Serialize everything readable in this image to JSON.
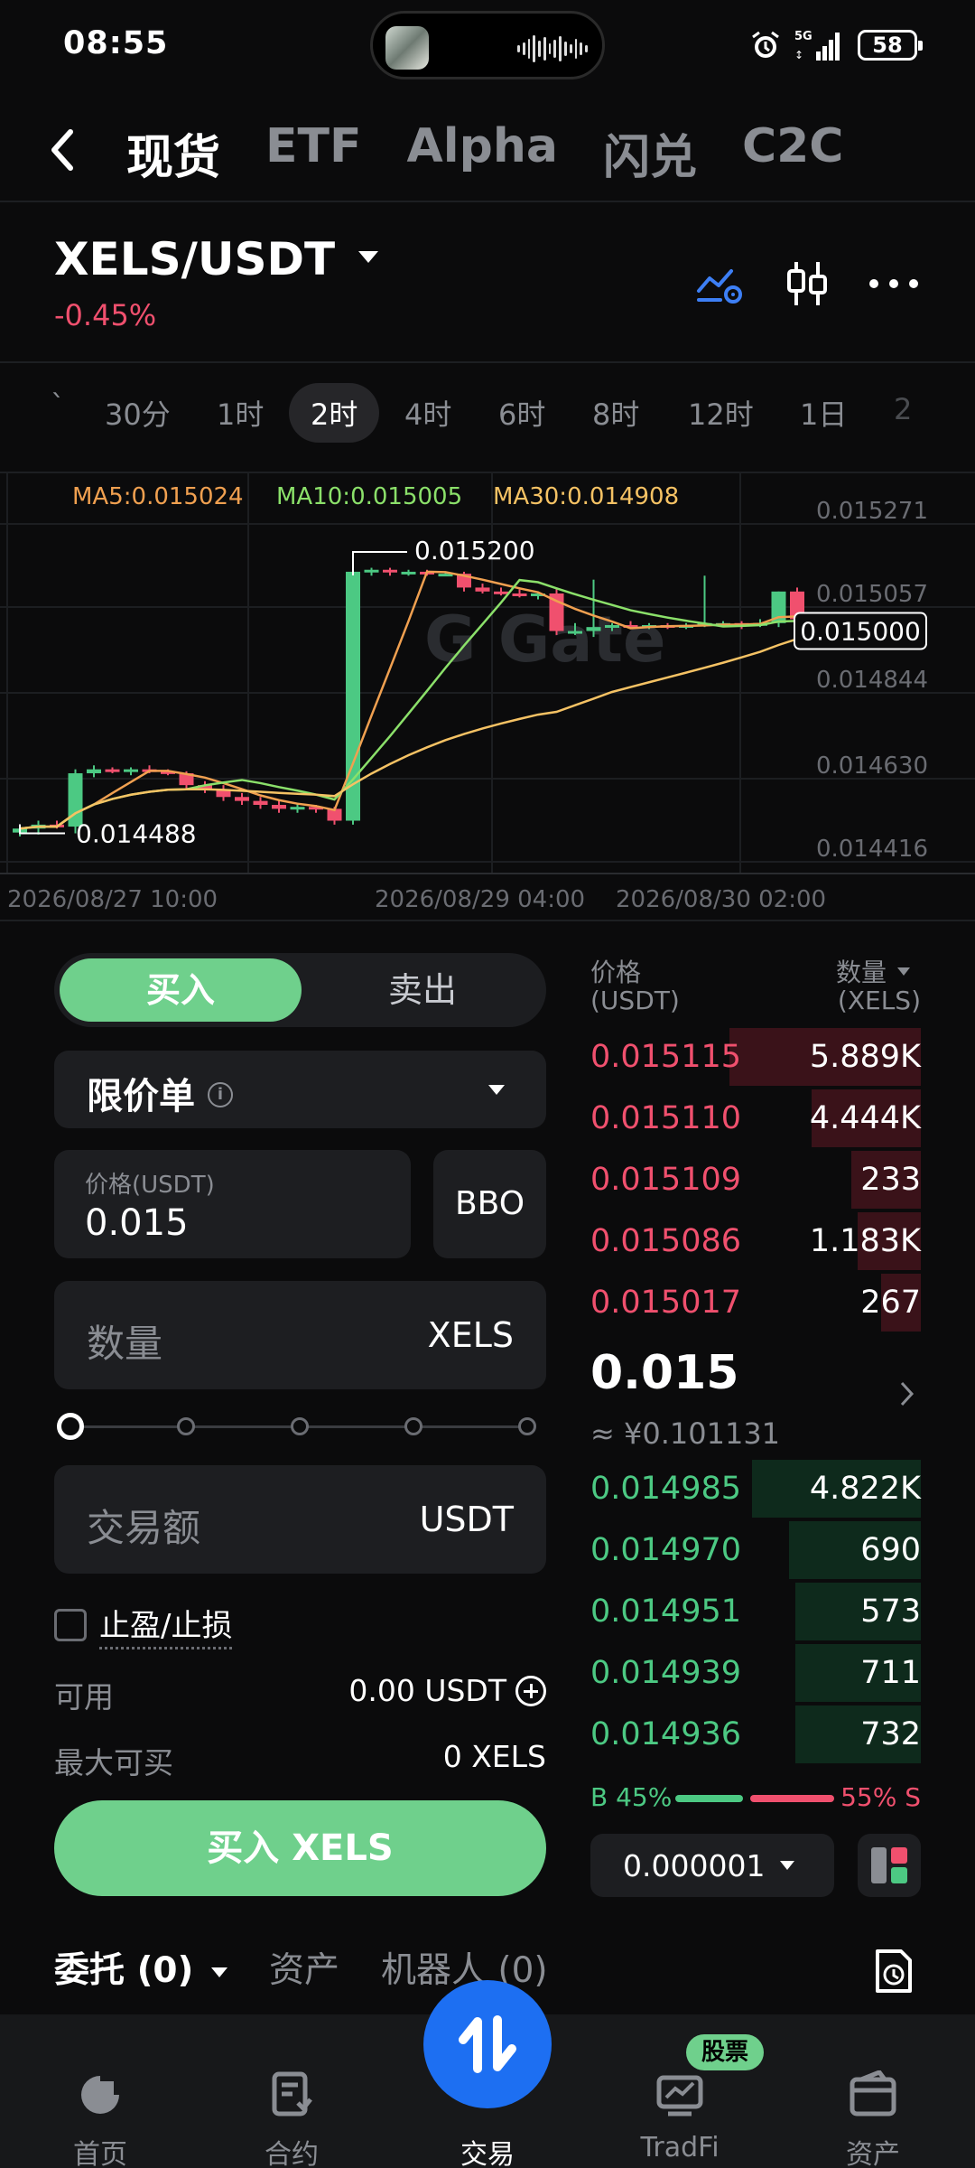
{
  "status": {
    "time": "08:55",
    "battery": "58",
    "network": "5G"
  },
  "topnav": {
    "tabs": [
      "现货",
      "ETF",
      "Alpha",
      "闪兑",
      "C2C"
    ],
    "active": 0
  },
  "pair": {
    "symbol": "XELS/USDT",
    "change": "-0.45%"
  },
  "timeframes": {
    "items": [
      "30分",
      "1时",
      "2时",
      "4时",
      "6时",
      "8时",
      "12时",
      "1日",
      "2"
    ],
    "active": "2时"
  },
  "chart_data": {
    "type": "candlestick",
    "ma": [
      {
        "name": "MA5",
        "label": "MA5:0.015024",
        "color": "#f0a050"
      },
      {
        "name": "MA10",
        "label": "MA10:0.015005",
        "color": "#8be06a"
      },
      {
        "name": "MA30",
        "label": "MA30:0.014908",
        "color": "#f5c264"
      }
    ],
    "y_ticks": [
      "0.015271",
      "0.015057",
      "0.014844",
      "0.014630",
      "0.014416"
    ],
    "x_ticks": [
      "2026/08/27 10:00",
      "2026/08/29 04:00",
      "2026/08/30 02:00"
    ],
    "high_label": "0.015200",
    "low_label": "0.014488",
    "last_price": "0.015000",
    "candles": [
      {
        "o": 0.01449,
        "h": 0.0145,
        "l": 0.01448,
        "c": 0.0145
      },
      {
        "o": 0.0145,
        "h": 0.01452,
        "l": 0.014485,
        "c": 0.01451
      },
      {
        "o": 0.01451,
        "h": 0.01452,
        "l": 0.0145,
        "c": 0.014505
      },
      {
        "o": 0.014505,
        "h": 0.01465,
        "l": 0.014488,
        "c": 0.01464
      },
      {
        "o": 0.01464,
        "h": 0.01466,
        "l": 0.01463,
        "c": 0.01465
      },
      {
        "o": 0.01465,
        "h": 0.014655,
        "l": 0.01464,
        "c": 0.014645
      },
      {
        "o": 0.014645,
        "h": 0.014655,
        "l": 0.014635,
        "c": 0.01465
      },
      {
        "o": 0.01465,
        "h": 0.01466,
        "l": 0.01464,
        "c": 0.014645
      },
      {
        "o": 0.014645,
        "h": 0.01465,
        "l": 0.014635,
        "c": 0.01464
      },
      {
        "o": 0.01464,
        "h": 0.014645,
        "l": 0.0146,
        "c": 0.01461
      },
      {
        "o": 0.01461,
        "h": 0.01462,
        "l": 0.01459,
        "c": 0.0146
      },
      {
        "o": 0.0146,
        "h": 0.01461,
        "l": 0.01457,
        "c": 0.01458
      },
      {
        "o": 0.01458,
        "h": 0.01459,
        "l": 0.01456,
        "c": 0.01457
      },
      {
        "o": 0.01457,
        "h": 0.01458,
        "l": 0.01455,
        "c": 0.01456
      },
      {
        "o": 0.01456,
        "h": 0.01457,
        "l": 0.01454,
        "c": 0.01455
      },
      {
        "o": 0.01455,
        "h": 0.014565,
        "l": 0.01454,
        "c": 0.014555
      },
      {
        "o": 0.014555,
        "h": 0.01456,
        "l": 0.01454,
        "c": 0.01455
      },
      {
        "o": 0.01455,
        "h": 0.014555,
        "l": 0.01451,
        "c": 0.01452
      },
      {
        "o": 0.01452,
        "h": 0.0152,
        "l": 0.01451,
        "c": 0.01515
      },
      {
        "o": 0.01515,
        "h": 0.01516,
        "l": 0.01514,
        "c": 0.015155
      },
      {
        "o": 0.015155,
        "h": 0.01516,
        "l": 0.01514,
        "c": 0.01515
      },
      {
        "o": 0.01515,
        "h": 0.015155,
        "l": 0.01514,
        "c": 0.01515
      },
      {
        "o": 0.01515,
        "h": 0.015155,
        "l": 0.01514,
        "c": 0.015145
      },
      {
        "o": 0.015145,
        "h": 0.01515,
        "l": 0.01514,
        "c": 0.015145
      },
      {
        "o": 0.015145,
        "h": 0.01515,
        "l": 0.0151,
        "c": 0.01511
      },
      {
        "o": 0.01511,
        "h": 0.01512,
        "l": 0.015095,
        "c": 0.0151
      },
      {
        "o": 0.0151,
        "h": 0.01511,
        "l": 0.01509,
        "c": 0.015095
      },
      {
        "o": 0.015095,
        "h": 0.015105,
        "l": 0.015085,
        "c": 0.01509
      },
      {
        "o": 0.01509,
        "h": 0.0151,
        "l": 0.01508,
        "c": 0.015095
      },
      {
        "o": 0.015095,
        "h": 0.01511,
        "l": 0.01499,
        "c": 0.015
      },
      {
        "o": 0.015,
        "h": 0.01502,
        "l": 0.01499,
        "c": 0.015
      },
      {
        "o": 0.015,
        "h": 0.01513,
        "l": 0.014985,
        "c": 0.01501
      },
      {
        "o": 0.01501,
        "h": 0.01502,
        "l": 0.015,
        "c": 0.015015
      },
      {
        "o": 0.015015,
        "h": 0.015025,
        "l": 0.015005,
        "c": 0.01501
      },
      {
        "o": 0.01501,
        "h": 0.01502,
        "l": 0.015005,
        "c": 0.015015
      },
      {
        "o": 0.015015,
        "h": 0.01502,
        "l": 0.015005,
        "c": 0.01501
      },
      {
        "o": 0.01501,
        "h": 0.01502,
        "l": 0.015005,
        "c": 0.015015
      },
      {
        "o": 0.015015,
        "h": 0.01514,
        "l": 0.01501,
        "c": 0.01502
      },
      {
        "o": 0.01502,
        "h": 0.015025,
        "l": 0.01501,
        "c": 0.01502
      },
      {
        "o": 0.01502,
        "h": 0.015025,
        "l": 0.015005,
        "c": 0.015015
      },
      {
        "o": 0.015015,
        "h": 0.01503,
        "l": 0.01501,
        "c": 0.01502
      },
      {
        "o": 0.01502,
        "h": 0.0151,
        "l": 0.01501,
        "c": 0.0151
      },
      {
        "o": 0.0151,
        "h": 0.01511,
        "l": 0.01502,
        "c": 0.01503
      }
    ]
  },
  "trade": {
    "buy_tab": "买入",
    "sell_tab": "卖出",
    "order_type": "限价单",
    "price_label": "价格(USDT)",
    "price_value": "0.015",
    "bbo": "BBO",
    "qty_placeholder": "数量",
    "qty_unit": "XELS",
    "amount_placeholder": "交易额",
    "amount_unit": "USDT",
    "tpsl": "止盈/止损",
    "available_label": "可用",
    "available_value": "0.00 USDT",
    "maxbuy_label": "最大可买",
    "maxbuy_value": "0 XELS",
    "buy_button": "买入 XELS"
  },
  "orderbook": {
    "price_header": "价格",
    "price_unit": "(USDT)",
    "qty_header": "数量",
    "qty_unit": "(XELS)",
    "asks": [
      {
        "price": "0.015115",
        "qty": "5.889K",
        "depth": 0.58
      },
      {
        "price": "0.015110",
        "qty": "4.444K",
        "depth": 0.33
      },
      {
        "price": "0.015109",
        "qty": "233",
        "depth": 0.21
      },
      {
        "price": "0.015086",
        "qty": "1.183K",
        "depth": 0.19
      },
      {
        "price": "0.015017",
        "qty": "267",
        "depth": 0.12
      }
    ],
    "last": "0.015",
    "last_cny": "≈ ¥0.101131",
    "bids": [
      {
        "price": "0.014985",
        "qty": "4.822K",
        "depth": 0.51
      },
      {
        "price": "0.014970",
        "qty": "690",
        "depth": 0.4
      },
      {
        "price": "0.014951",
        "qty": "573",
        "depth": 0.38
      },
      {
        "price": "0.014939",
        "qty": "711",
        "depth": 0.38
      },
      {
        "price": "0.014936",
        "qty": "732",
        "depth": 0.38
      }
    ],
    "buy_ratio": "B 45%",
    "sell_ratio": "55% S",
    "buy_pct": 45,
    "tick_size": "0.000001"
  },
  "bottom_tabs": {
    "orders": "委托 (0)",
    "assets": "资产",
    "bots": "机器人 (0)"
  },
  "navbar": {
    "home": "首页",
    "futures": "合约",
    "trade": "交易",
    "tradfi": "TradFi",
    "assets": "资产",
    "badge": "股票"
  },
  "colors": {
    "up": "#4cc983",
    "down": "#f0506e",
    "accent": "#6fd08c",
    "brand": "#1d6ff2"
  }
}
